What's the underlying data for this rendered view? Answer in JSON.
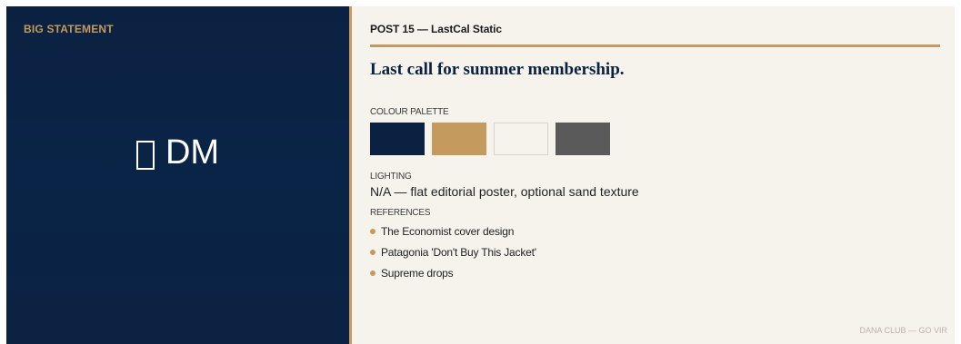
{
  "left": {
    "label": "BIG STATEMENT",
    "glyph_icon": "missing-glyph-box",
    "center_text": "DM"
  },
  "right": {
    "post_heading": "POST 15 — LastCal Static",
    "headline": "Last call for summer membership.",
    "palette_label": "COLOUR PALETTE",
    "palette": [
      "#0b2142",
      "#c49a5e",
      "#f6f3ed",
      "#5a5a5a"
    ],
    "lighting_label": "LIGHTING",
    "lighting_text": "N/A — flat editorial poster, optional sand texture",
    "references_label": "REFERENCES",
    "references": [
      "The Economist cover design",
      "Patagonia 'Don't Buy This Jacket'",
      "Supreme drops"
    ],
    "footer": "DANA CLUB — GO VIR"
  },
  "colors": {
    "navy": "#0b2142",
    "sand": "#c49a5e",
    "cream": "#f6f3ed"
  }
}
